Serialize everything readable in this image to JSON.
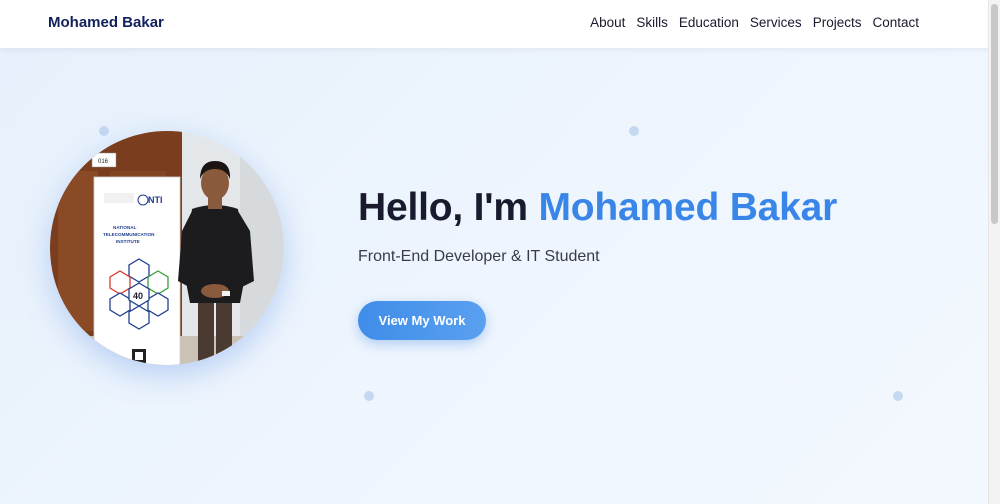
{
  "nav": {
    "brand": "Mohamed Bakar",
    "links": [
      "About",
      "Skills",
      "Education",
      "Services",
      "Projects",
      "Contact"
    ]
  },
  "hero": {
    "greeting": "Hello, I'm ",
    "name": "Mohamed Bakar",
    "subtitle": "Front-End Developer & IT Student",
    "cta_label": "View My Work",
    "photo_alt": "Profile photo",
    "banner": {
      "room_number": "016",
      "org_short": "NTI",
      "org_line1": "NATIONAL",
      "org_line2": "TELECOMMUNICATION",
      "org_line3": "INSTITUTE",
      "anniversary": "40"
    }
  },
  "colors": {
    "accent": "#3a86e8",
    "brand": "#12205c",
    "cta_bg": "#3f8de9"
  }
}
